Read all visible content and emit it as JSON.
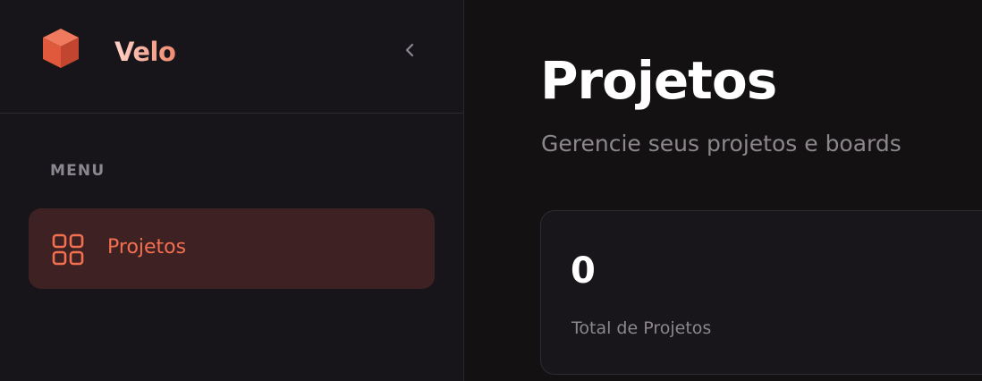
{
  "sidebar": {
    "brand": {
      "name": "Velo",
      "logo_icon": "cube-icon"
    },
    "collapse_icon": "chevron-left-icon",
    "section_label": "MENU",
    "items": [
      {
        "label": "Projetos",
        "icon": "grid-icon",
        "active": true
      }
    ]
  },
  "main": {
    "title": "Projetos",
    "subtitle": "Gerencie seus projetos e boards",
    "stats": [
      {
        "value": "0",
        "label": "Total de Projetos"
      }
    ]
  },
  "colors": {
    "accent": "#f26f50",
    "active_bg": "#3e2123",
    "background": "#141113",
    "sidebar_bg": "#17151a"
  }
}
